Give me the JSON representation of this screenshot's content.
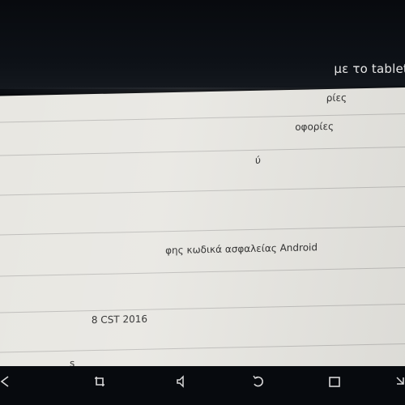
{
  "header": {
    "title": "με το tablet"
  },
  "rows": [
    {
      "label": "ρίες"
    },
    {
      "label": "οφορίες"
    },
    {
      "label": "ύ"
    },
    {
      "label": ""
    },
    {
      "label": "φης κωδικά ασφαλείας Android"
    },
    {
      "label": ""
    },
    {
      "label": "8 CST 2016"
    },
    {
      "label": "s"
    }
  ],
  "navbar": {
    "icons": [
      "back-icon",
      "screenshot-icon",
      "volume-down-icon",
      "home-icon",
      "recent-apps-icon"
    ]
  },
  "colors": {
    "panel": "#e8e7e2",
    "bar": "#0a0d12",
    "divider": "#bfbebb"
  }
}
